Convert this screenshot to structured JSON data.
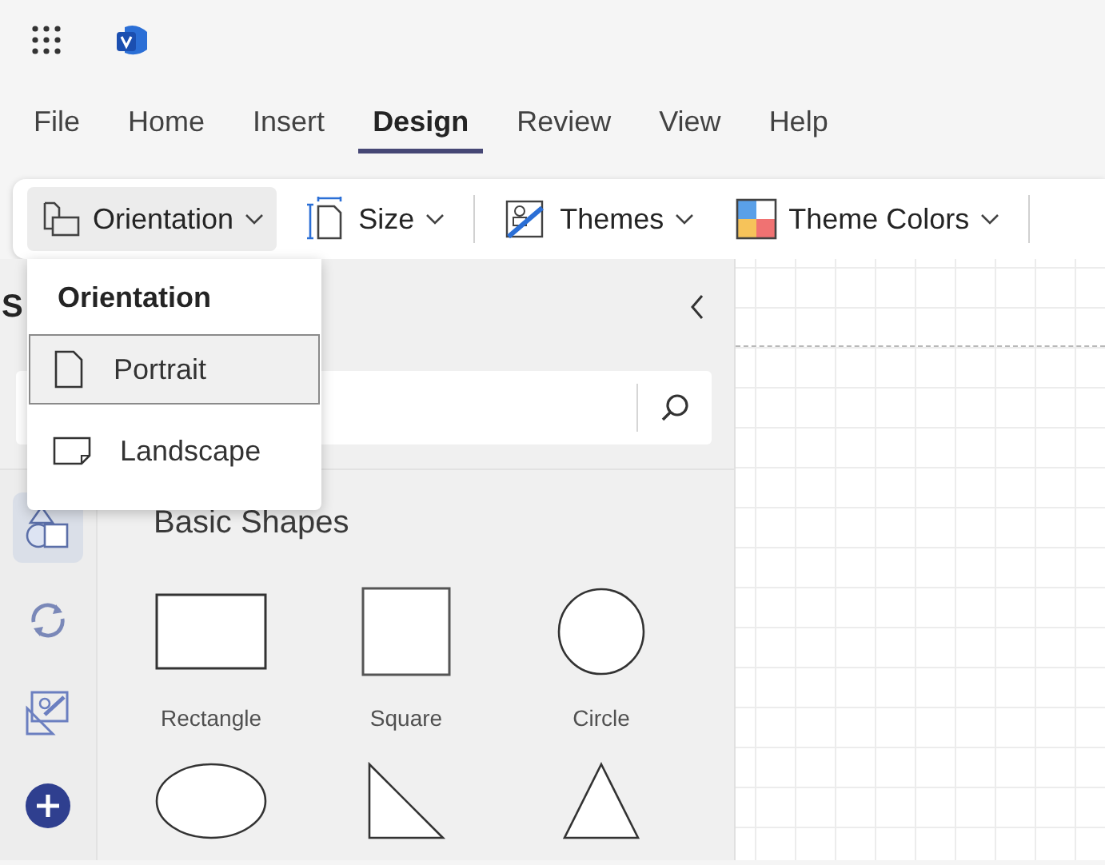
{
  "menu_tabs": [
    {
      "label": "File",
      "selected": false
    },
    {
      "label": "Home",
      "selected": false
    },
    {
      "label": "Insert",
      "selected": false
    },
    {
      "label": "Design",
      "selected": true
    },
    {
      "label": "Review",
      "selected": false
    },
    {
      "label": "View",
      "selected": false
    },
    {
      "label": "Help",
      "selected": false
    }
  ],
  "ribbon": [
    {
      "kind": "dropdown",
      "label": "Orientation",
      "pressed": true
    },
    {
      "kind": "dropdown",
      "label": "Size",
      "pressed": false
    },
    {
      "kind": "divider"
    },
    {
      "kind": "dropdown",
      "label": "Themes",
      "pressed": false
    },
    {
      "kind": "dropdown",
      "label": "Theme Colors",
      "pressed": false
    },
    {
      "kind": "divider"
    }
  ],
  "orientation_menu": {
    "title": "Orientation",
    "items": [
      {
        "kind": "portrait",
        "label": "Portrait",
        "selected": true
      },
      {
        "kind": "landscape",
        "label": "Landscape",
        "selected": false
      }
    ]
  },
  "shapes_panel": {
    "title": "S",
    "rail": [
      {
        "kind": "shapes",
        "selected": true
      },
      {
        "kind": "sync",
        "selected": false
      },
      {
        "kind": "stencil",
        "selected": false
      },
      {
        "kind": "add",
        "selected": false
      }
    ],
    "section_title": "Basic Shapes",
    "shapes": [
      {
        "kind": "rectangle",
        "label": "Rectangle"
      },
      {
        "kind": "square",
        "label": "Square"
      },
      {
        "kind": "circle",
        "label": "Circle"
      },
      {
        "kind": "ellipse"
      },
      {
        "kind": "right-triangle"
      },
      {
        "kind": "triangle"
      }
    ]
  }
}
